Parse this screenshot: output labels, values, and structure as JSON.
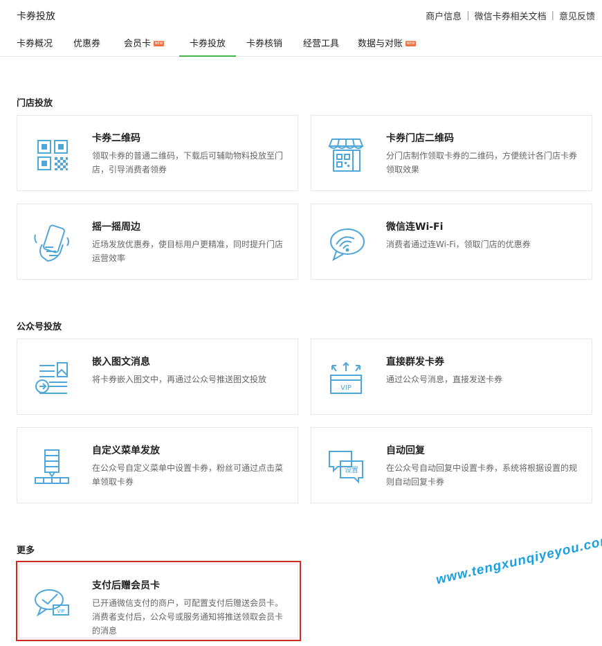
{
  "header": {
    "title": "卡券投放",
    "links": [
      "商户信息",
      "微信卡券相关文档",
      "意见反馈"
    ]
  },
  "tabs": [
    {
      "label": "卡券概况",
      "new": false,
      "active": false
    },
    {
      "label": "优惠券",
      "new": false,
      "active": false
    },
    {
      "label": "会员卡",
      "new": true,
      "active": false
    },
    {
      "label": "卡券投放",
      "new": false,
      "active": true
    },
    {
      "label": "卡券核销",
      "new": false,
      "active": false
    },
    {
      "label": "经营工具",
      "new": false,
      "active": false
    },
    {
      "label": "数据与对账",
      "new": true,
      "active": false
    }
  ],
  "new_badge_text": "NEW",
  "sections": {
    "store": {
      "title": "门店投放",
      "cards": [
        {
          "icon": "qrcode-icon",
          "title": "卡券二维码",
          "desc": "领取卡券的普通二维码，下载后可辅助物料投放至门店，引导消费者领券"
        },
        {
          "icon": "store-qrcode-icon",
          "title": "卡券门店二维码",
          "desc": "分门店制作领取卡券的二维码，方便统计各门店卡券领取效果"
        },
        {
          "icon": "shake-phone-icon",
          "title": "摇一摇周边",
          "desc": "近场发放优惠券，使目标用户更精准，同时提升门店运营效率"
        },
        {
          "icon": "wifi-icon",
          "title": "微信连Wi-Fi",
          "desc": "消费者通过连Wi-Fi，领取门店的优惠券"
        }
      ]
    },
    "official": {
      "title": "公众号投放",
      "cards": [
        {
          "icon": "article-embed-icon",
          "title": "嵌入图文消息",
          "desc": "将卡券嵌入图文中，再通过公众号推送图文投放"
        },
        {
          "icon": "vip-broadcast-icon",
          "title": "直接群发卡券",
          "desc": "通过公众号消息，直接发送卡券"
        },
        {
          "icon": "custom-menu-icon",
          "title": "自定义菜单发放",
          "desc": "在公众号自定义菜单中设置卡券，粉丝可通过点击菜单领取卡券"
        },
        {
          "icon": "auto-reply-icon",
          "title": "自动回复",
          "desc": "在公众号自动回复中设置卡券，系统将根据设置的规则自动回复卡券"
        }
      ]
    },
    "more": {
      "title": "更多",
      "cards": [
        {
          "icon": "pay-vip-card-icon",
          "title": "支付后赠会员卡",
          "desc": "已开通微信支付的商户，可配置支付后赠送会员卡。消费者支付后，公众号或服务通知将推送领取会员卡的消息"
        }
      ]
    }
  },
  "icon_labels": {
    "vip": "VIP",
    "settings": "设置"
  },
  "watermark": "www.tengxunqiyeyou.com",
  "colors": {
    "accent": "#44b549",
    "icon": "#4fa6d9",
    "highlight": "#d0271f",
    "badge": "#f0723e",
    "watermark": "#1a9fe0"
  }
}
